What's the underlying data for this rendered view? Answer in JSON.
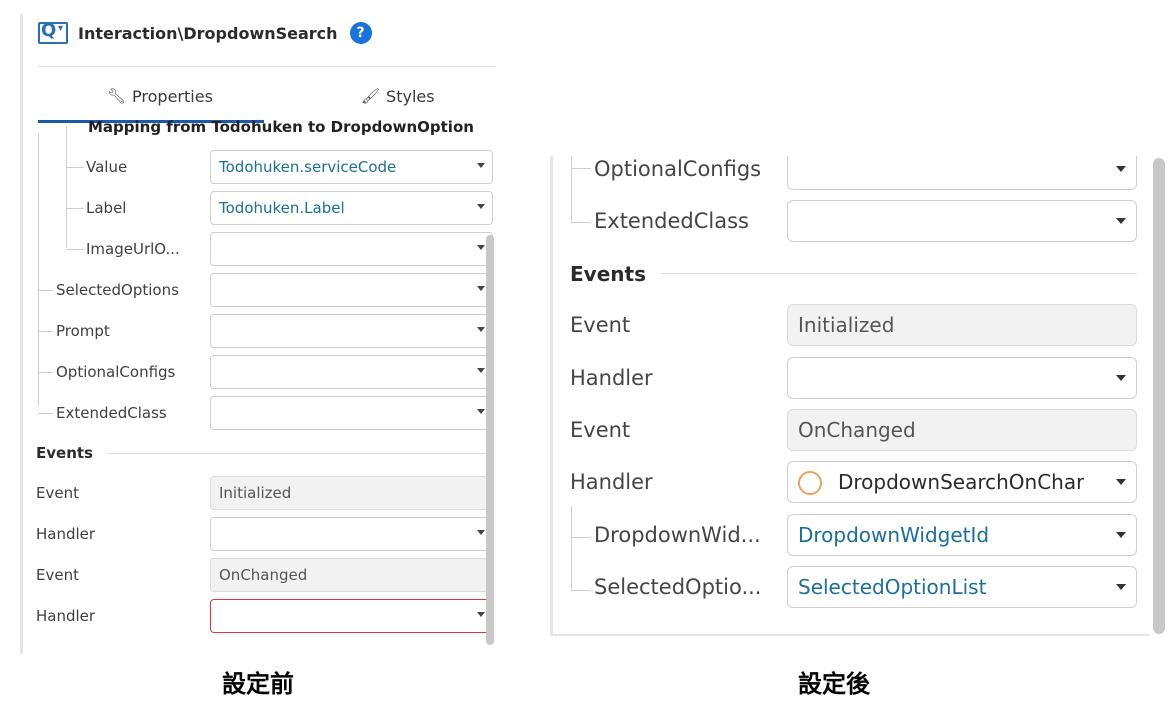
{
  "left": {
    "title": "Interaction\\DropdownSearch",
    "help": "?",
    "tabs": {
      "properties": "Properties",
      "styles": "Styles"
    },
    "mapping_heading": "Mapping from Todohuken to DropdownOption",
    "rows": [
      {
        "label": "Value",
        "value": "Todohuken.serviceCode"
      },
      {
        "label": "Label",
        "value": "Todohuken.Label"
      },
      {
        "label": "ImageUrlO...",
        "value": ""
      },
      {
        "label": "SelectedOptions",
        "value": ""
      },
      {
        "label": "Prompt",
        "value": ""
      },
      {
        "label": "OptionalConfigs",
        "value": ""
      },
      {
        "label": "ExtendedClass",
        "value": ""
      }
    ],
    "events_title": "Events",
    "events": [
      {
        "label": "Event",
        "value": "Initialized"
      },
      {
        "label": "Handler",
        "value": ""
      },
      {
        "label": "Event",
        "value": "OnChanged"
      },
      {
        "label": "Handler",
        "value": ""
      }
    ],
    "caption": "設定前"
  },
  "right": {
    "rows": [
      {
        "label": "OptionalConfigs",
        "value": ""
      },
      {
        "label": "ExtendedClass",
        "value": ""
      }
    ],
    "events_title": "Events",
    "events": [
      {
        "label": "Event",
        "value": "Initialized"
      },
      {
        "label": "Handler",
        "value": ""
      },
      {
        "label": "Event",
        "value": "OnChanged"
      },
      {
        "label": "Handler",
        "value": "DropdownSearchOnChar"
      }
    ],
    "params": [
      {
        "label": "DropdownWid...",
        "value": "DropdownWidgetId"
      },
      {
        "label": "SelectedOptio...",
        "value": "SelectedOptionList"
      }
    ],
    "caption": "設定後"
  },
  "colors": {
    "accent": "#1f58a8",
    "value_text": "#1c6f97",
    "error_border": "#d63a3a",
    "handler_circle": "#f0a05a"
  },
  "icons": [
    "dropdown-search-widget-icon",
    "help-icon",
    "wrench-icon",
    "brush-icon",
    "chevron-down-icon",
    "handler-circle-icon"
  ]
}
